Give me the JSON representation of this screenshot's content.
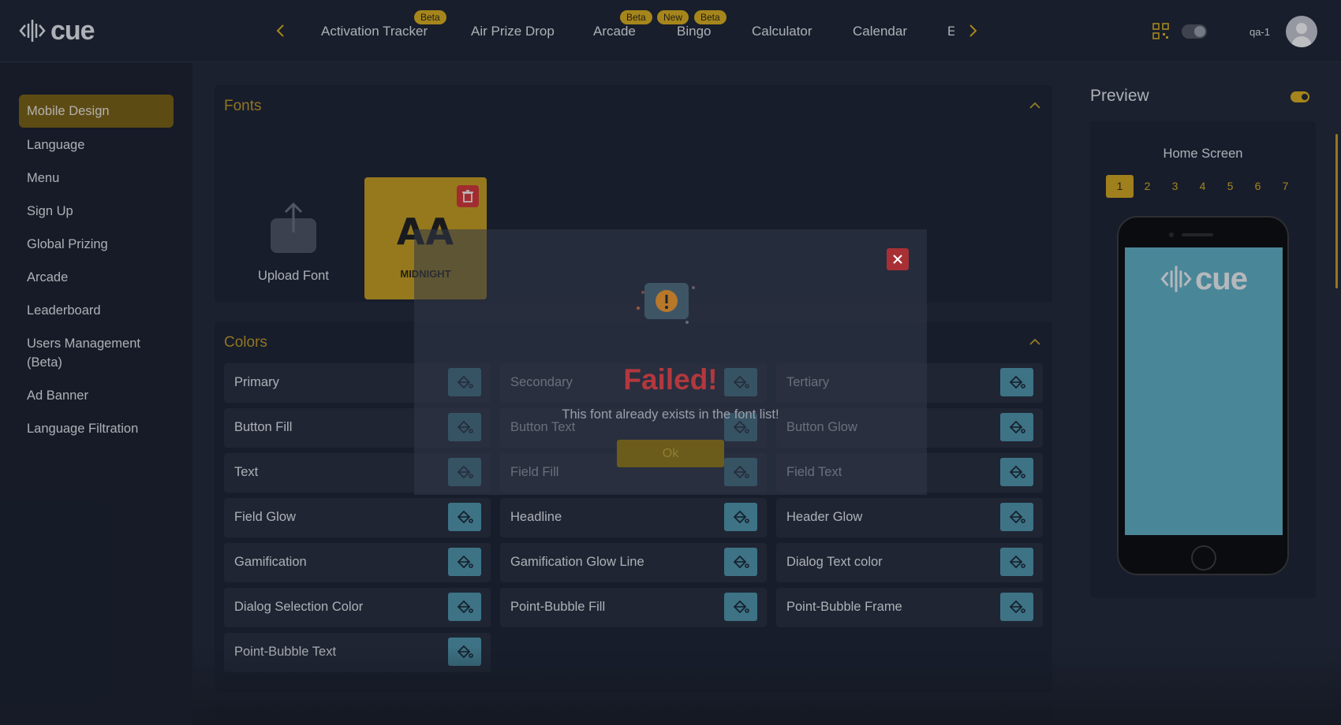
{
  "brand": {
    "name": "cue"
  },
  "topnav": {
    "tabs": [
      {
        "label": "Activation Tracker",
        "badges": [
          "Beta"
        ]
      },
      {
        "label": "Air Prize Drop",
        "badges": []
      },
      {
        "label": "Arcade",
        "badges": [
          "Beta"
        ]
      },
      {
        "label": "Bingo",
        "badges": [
          "New",
          "Beta"
        ]
      },
      {
        "label": "Calculator",
        "badges": []
      },
      {
        "label": "Calendar",
        "badges": []
      },
      {
        "label": "E",
        "badges": []
      }
    ],
    "username": "qa-1",
    "accent": "#e0b21b"
  },
  "sidebar": {
    "items": [
      {
        "label": "Mobile Design",
        "active": true
      },
      {
        "label": "Language"
      },
      {
        "label": "Menu"
      },
      {
        "label": "Sign Up"
      },
      {
        "label": "Global Prizing"
      },
      {
        "label": "Arcade"
      },
      {
        "label": "Leaderboard"
      },
      {
        "label": "Users Management (Beta)"
      },
      {
        "label": "Ad Banner"
      },
      {
        "label": "Language Filtration"
      }
    ]
  },
  "fonts": {
    "title": "Fonts",
    "upload_label": "Upload Font",
    "items": [
      {
        "preview": "AA",
        "name": "MIDNIGHT"
      }
    ]
  },
  "colors": {
    "title": "Colors",
    "items": [
      "Primary",
      "Secondary",
      "Tertiary",
      "Button Fill",
      "Button Text",
      "Button Glow",
      "Text",
      "Field Fill",
      "Field Text",
      "Field Glow",
      "Headline",
      "Header Glow",
      "Gamification",
      "Gamification Glow Line",
      "Dialog Text color",
      "Dialog Selection Color",
      "Point-Bubble Fill",
      "Point-Bubble Frame",
      "Point-Bubble Text"
    ]
  },
  "preview": {
    "title": "Preview",
    "screen_title": "Home Screen",
    "pages": [
      "1",
      "2",
      "3",
      "4",
      "5",
      "6",
      "7"
    ],
    "active_page": "1",
    "screen_color": "#5fb2c6"
  },
  "dialog": {
    "title": "Failed!",
    "message": "This font already exists in the font list!",
    "ok_label": "Ok"
  }
}
